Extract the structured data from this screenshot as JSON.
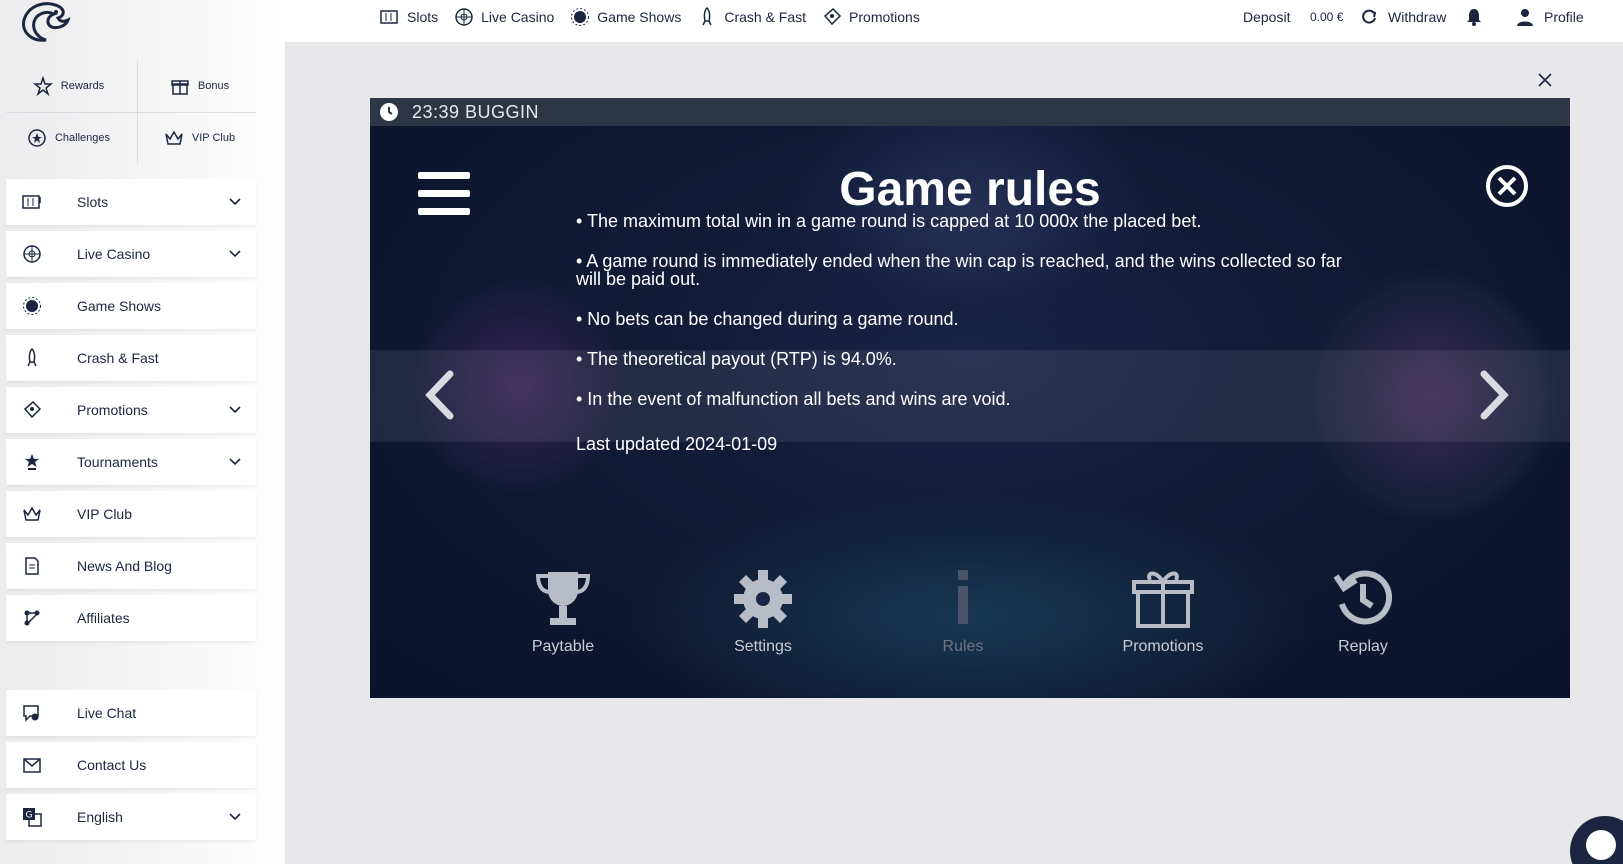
{
  "colors": {
    "accent": "#1c2640",
    "sidebar_bg": "#f2f2f4",
    "content_bg": "#e8e8ea",
    "game_title_bar": "#2e3547"
  },
  "sidebar": {
    "logo_icon": "eagle-logo-icon",
    "quick_links": [
      {
        "label": "Rewards",
        "icon": "star-badge-icon"
      },
      {
        "label": "Bonus",
        "icon": "gift-icon"
      },
      {
        "label": "Challenges",
        "icon": "star-medal-icon"
      },
      {
        "label": "VIP Club",
        "icon": "crown-icon"
      }
    ],
    "items": [
      {
        "label": "Slots",
        "icon": "slot-machine-icon",
        "has_chevron": true
      },
      {
        "label": "Live Casino",
        "icon": "roulette-icon",
        "has_chevron": true
      },
      {
        "label": "Game Shows",
        "icon": "spinner-wheel-icon",
        "has_chevron": false
      },
      {
        "label": "Crash & Fast",
        "icon": "rocket-icon",
        "has_chevron": false
      },
      {
        "label": "Promotions",
        "icon": "ticket-icon",
        "has_chevron": true
      },
      {
        "label": "Tournaments",
        "icon": "trophy-star-icon",
        "has_chevron": true
      },
      {
        "label": "VIP Club",
        "icon": "crown-icon",
        "has_chevron": false
      },
      {
        "label": "News And Blog",
        "icon": "document-icon",
        "has_chevron": false
      },
      {
        "label": "Affiliates",
        "icon": "network-icon",
        "has_chevron": false
      }
    ],
    "bottom_items": [
      {
        "label": "Live Chat",
        "icon": "chat-icon",
        "has_chevron": false
      },
      {
        "label": "Contact Us",
        "icon": "mail-icon",
        "has_chevron": false
      },
      {
        "label": "English",
        "icon": "translate-icon",
        "has_chevron": true
      }
    ]
  },
  "topbar": {
    "nav": [
      {
        "label": "Slots",
        "icon": "slot-machine-icon"
      },
      {
        "label": "Live Casino",
        "icon": "roulette-icon"
      },
      {
        "label": "Game Shows",
        "icon": "spinner-wheel-icon"
      },
      {
        "label": "Crash & Fast",
        "icon": "rocket-icon"
      },
      {
        "label": "Promotions",
        "icon": "ticket-icon"
      }
    ],
    "deposit_label": "Deposit",
    "balance": "0.00 €",
    "withdraw_label": "Withdraw",
    "profile_label": "Profile"
  },
  "game": {
    "window_title": "23:39 BUGGIN",
    "rules_title": "Game rules",
    "rules": [
      "• The maximum total win in a game round is capped at 10 000x the placed bet.",
      "• A game round is immediately ended when the win cap is reached, and the wins collected so far will be paid out.",
      "• No bets can be changed during a game round.",
      "• The theoretical payout (RTP) is 94.0%.",
      "• In the event of malfunction all bets and wins are void."
    ],
    "last_updated": "Last updated 2024-01-09",
    "menu": [
      {
        "label": "Paytable",
        "icon": "trophy-icon",
        "active": true
      },
      {
        "label": "Settings",
        "icon": "gear-icon",
        "active": true
      },
      {
        "label": "Rules",
        "icon": "info-icon",
        "active": false
      },
      {
        "label": "Promotions",
        "icon": "gift-icon",
        "active": true
      },
      {
        "label": "Replay",
        "icon": "replay-clock-icon",
        "active": true
      }
    ]
  }
}
